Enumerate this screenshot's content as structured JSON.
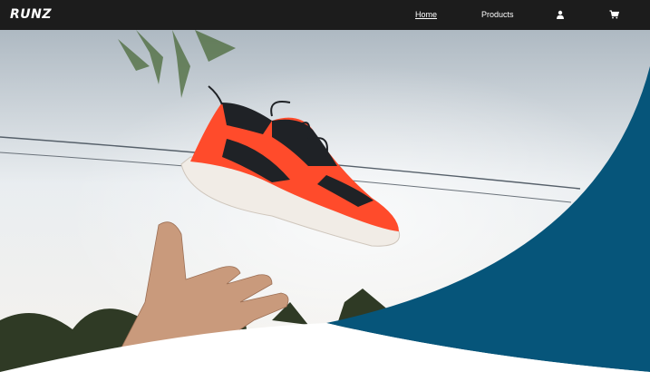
{
  "header": {
    "logo_text": "RUNZ",
    "nav": {
      "home_label": "Home",
      "products_label": "Products",
      "account_icon": "user-icon",
      "cart_icon": "shopping-cart-icon"
    }
  },
  "hero": {
    "image_description_icon": "hero-sneaker-image",
    "colors": {
      "accent_curve": "#06557a",
      "header_bg": "#1c1c1c",
      "sneaker": "#ff4b2b"
    }
  }
}
